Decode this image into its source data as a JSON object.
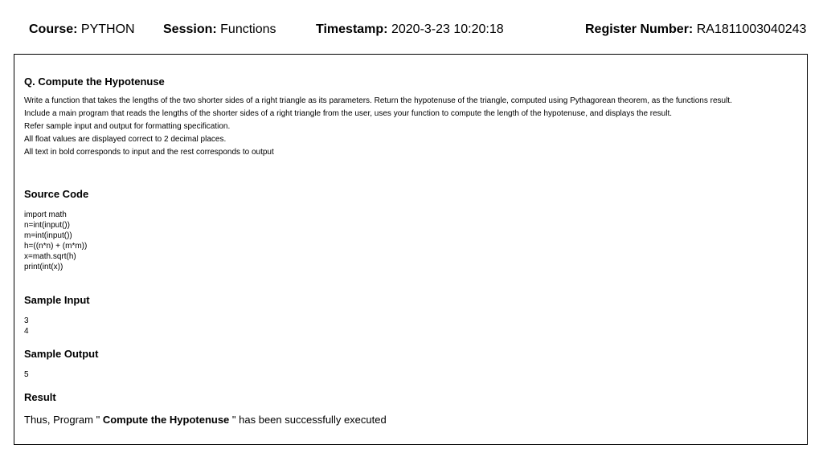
{
  "header": {
    "course_label": "Course:",
    "course_value": "PYTHON",
    "session_label": "Session:",
    "session_value": "Functions",
    "timestamp_label": "Timestamp:",
    "timestamp_value": "2020-3-23 10:20:18",
    "register_label": "Register Number:",
    "register_value": "RA1811003040243"
  },
  "question": {
    "title": "Q. Compute the Hypotenuse",
    "lines": [
      "Write a function that takes the lengths of the two shorter sides of a right triangle as its parameters. Return the hypotenuse of the triangle, computed using Pythagorean theorem, as the functions result.",
      "Include a main program that reads the lengths of the shorter sides of a right triangle from the user, uses your function to compute the length of the hypotenuse, and displays the result.",
      "Refer sample input and output for formatting specification.",
      "All float values are displayed correct to 2 decimal places.",
      "All text in bold corresponds to input and the rest corresponds to output"
    ]
  },
  "source_code": {
    "heading": "Source Code",
    "lines": [
      "import math",
      "n=int(input())",
      "m=int(input())",
      "h=((n*n) + (m*m))",
      "x=math.sqrt(h)",
      "print(int(x))"
    ]
  },
  "sample_input": {
    "heading": "Sample Input",
    "lines": [
      "3",
      "4"
    ]
  },
  "sample_output": {
    "heading": "Sample Output",
    "lines": [
      "5"
    ]
  },
  "result": {
    "heading": "Result",
    "prefix": "Thus, Program \"",
    "program_name": "Compute the Hypotenuse",
    "suffix": "\" has been successfully executed"
  }
}
